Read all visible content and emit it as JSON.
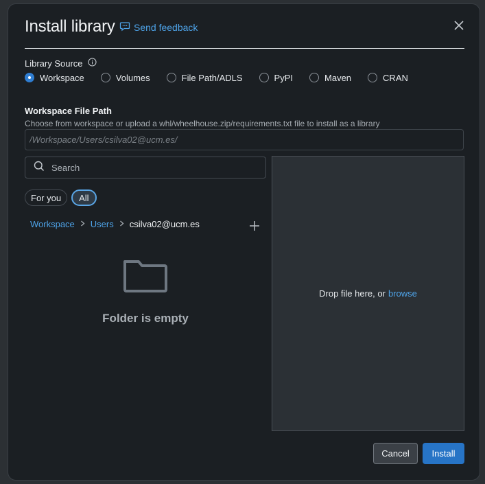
{
  "dialog": {
    "title": "Install library",
    "feedback_label": "Send feedback"
  },
  "source": {
    "label": "Library Source",
    "options": [
      "Workspace",
      "Volumes",
      "File Path/ADLS",
      "PyPI",
      "Maven",
      "CRAN"
    ],
    "selected": "Workspace"
  },
  "workspace_path": {
    "title": "Workspace File Path",
    "description": "Choose from workspace or upload a whl/wheelhouse.zip/requirements.txt file to install as a library",
    "placeholder": "/Workspace/Users/csilva02@ucm.es/"
  },
  "browser": {
    "search_placeholder": "Search",
    "filters": [
      "For you",
      "All"
    ],
    "active_filter": "All",
    "breadcrumb": [
      "Workspace",
      "Users",
      "csilva02@ucm.es"
    ],
    "empty_message": "Folder is empty"
  },
  "dropzone": {
    "text": "Drop file here, or",
    "browse_label": "browse"
  },
  "footer": {
    "cancel_label": "Cancel",
    "install_label": "Install"
  },
  "colors": {
    "accent": "#2f7dd1",
    "link": "#4ea3e8",
    "primary_button": "#2774c6"
  }
}
